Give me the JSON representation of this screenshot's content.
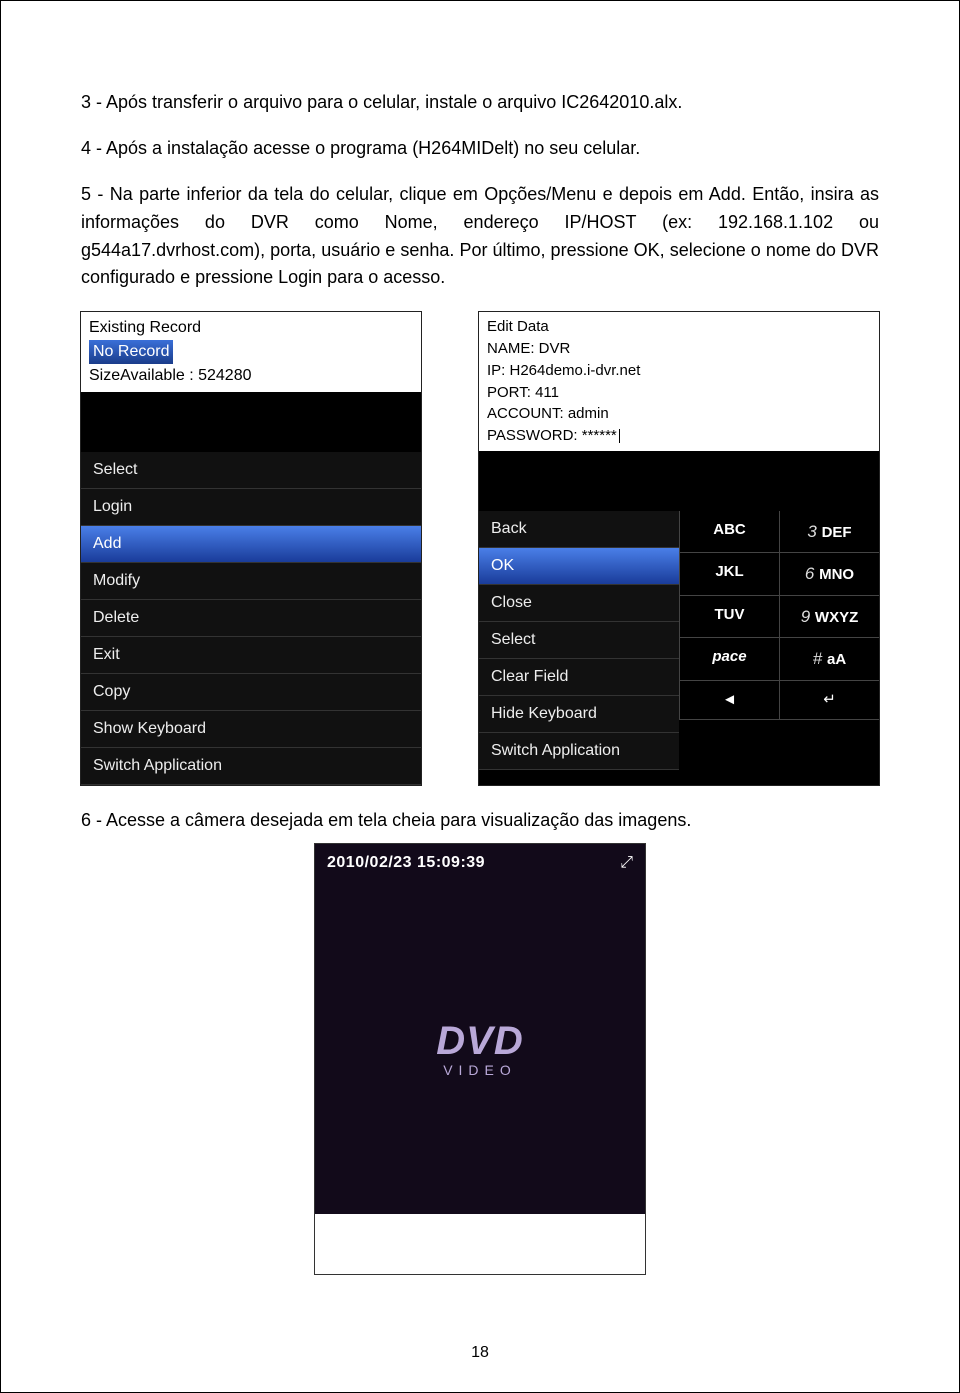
{
  "para1": "3 - Após transferir o arquivo para o celular, instale o arquivo IC2642010.alx.",
  "para2": "4 - Após a instalação acesse o programa (H264MIDelt) no seu celular.",
  "para3": "5 - Na parte inferior da tela do celular, clique em Opções/Menu e depois em Add. Então, insira as informações do DVR como Nome, endereço IP/HOST (ex: 192.168.1.102 ou g544a17.dvrhost.com), porta, usuário e senha. Por último, pressione OK, selecione o nome do DVR configurado e pressione Login para o acesso.",
  "screen1": {
    "title": "Existing Record",
    "selected": "No Record",
    "size": "SizeAvailable : 524280",
    "menu": [
      "Select",
      "Login",
      "Add",
      "Modify",
      "Delete",
      "Exit",
      "Copy",
      "Show Keyboard",
      "Switch Application"
    ],
    "highlightIndex": 2
  },
  "screen2": {
    "editTitle": "Edit Data",
    "fields": {
      "name": "NAME: DVR",
      "ip": "IP: H264demo.i-dvr.net",
      "port": "PORT: 411",
      "account": "ACCOUNT: admin",
      "password": "PASSWORD: ******"
    },
    "menu": [
      "Back",
      "OK",
      "Close",
      "Select",
      "Clear Field",
      "Hide Keyboard",
      "Switch Application"
    ],
    "highlightIndex": 1,
    "keys": [
      {
        "lab": "ABC",
        "num": "3",
        "lab2": "DEF"
      },
      {
        "lab": "JKL",
        "num": "6",
        "lab2": "MNO"
      },
      {
        "lab": "TUV",
        "num": "9",
        "lab2": "WXYZ"
      },
      {
        "lab": "pace",
        "num": "#",
        "lab2": "aA"
      }
    ]
  },
  "para4": "6 - Acesse a câmera desejada em tela cheia para visualização das imagens.",
  "screen3": {
    "timestamp": "2010/02/23 15:09:39",
    "logo": "DVD",
    "logoSub": "VIDEO"
  },
  "pageNumber": "18"
}
